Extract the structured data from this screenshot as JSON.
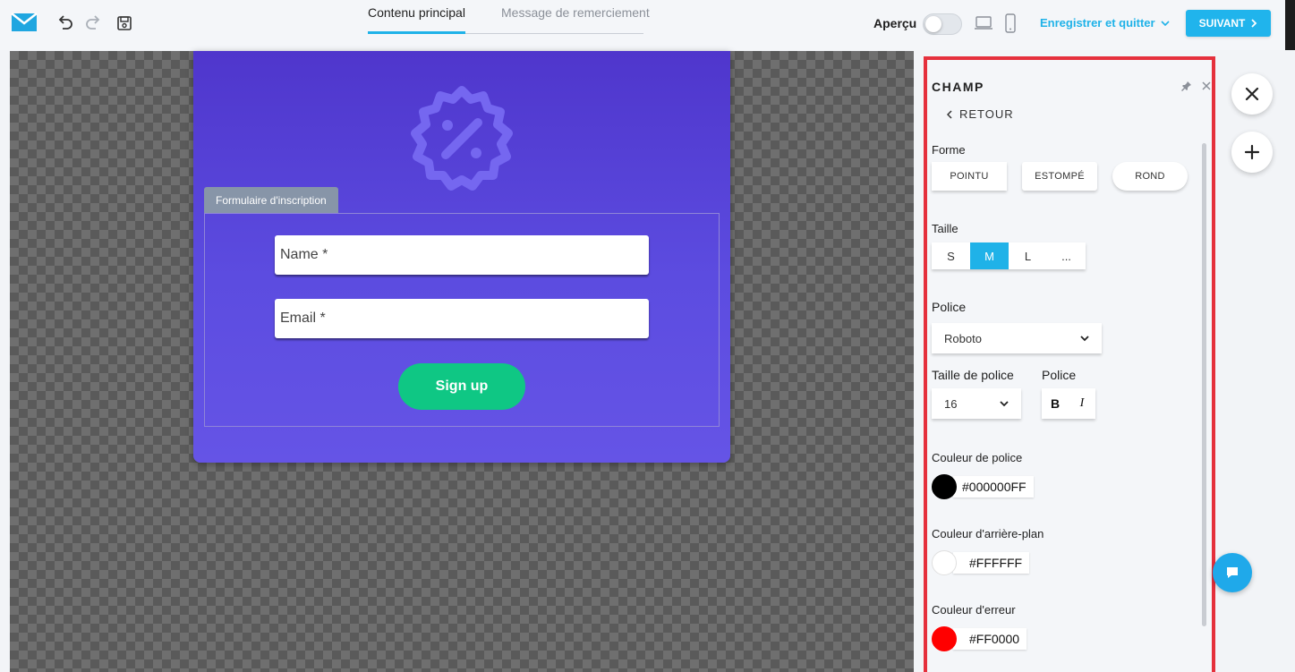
{
  "topbar": {
    "tabs": [
      {
        "label": "Contenu principal",
        "active": true
      },
      {
        "label": "Message de remerciement",
        "active": false
      }
    ],
    "preview_label": "Aperçu",
    "preview_on": false,
    "save_quit_label": "Enregistrer et quitter",
    "next_label": "SUIVANT"
  },
  "popup": {
    "form_tab_label": "Formulaire d'inscription",
    "name_placeholder": "Name *",
    "email_placeholder": "Email *",
    "signup_label": "Sign up"
  },
  "panel": {
    "title": "CHAMP",
    "back_label": "RETOUR",
    "shape": {
      "label": "Forme",
      "options": [
        "POINTU",
        "ESTOMPÉ",
        "ROND"
      ]
    },
    "size": {
      "label": "Taille",
      "options": [
        "S",
        "M",
        "L",
        "..."
      ],
      "selected": "M"
    },
    "font": {
      "label": "Police",
      "value": "Roboto"
    },
    "font_size": {
      "label": "Taille de police",
      "value": "16"
    },
    "font_style": {
      "label": "Police",
      "bold": "B",
      "italic": "I"
    },
    "font_color": {
      "label": "Couleur de police",
      "hex": "#000000FF",
      "swatch": "#000000"
    },
    "bg_color": {
      "label": "Couleur d'arrière-plan",
      "hex": "#FFFFFF",
      "swatch": "#FFFFFF"
    },
    "error_color": {
      "label": "Couleur d'erreur",
      "hex": "#FF0000",
      "swatch": "#FF0000"
    }
  },
  "colors": {
    "accent": "#1fb2e8",
    "popup_bg": "#5c4ce0",
    "signup_button": "#0fc784",
    "panel_border": "#e5303c"
  }
}
